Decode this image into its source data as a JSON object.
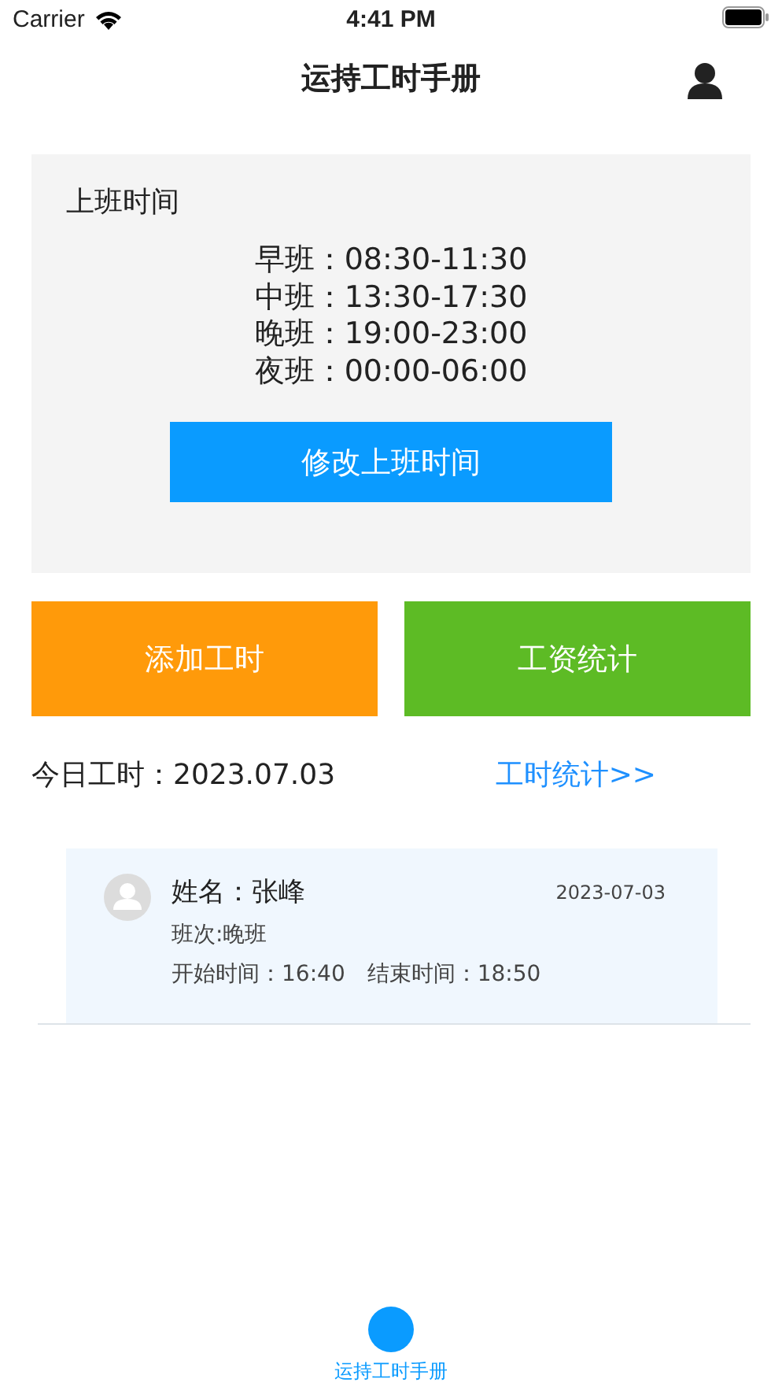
{
  "status_bar": {
    "carrier": "Carrier",
    "time": "4:41 PM"
  },
  "nav": {
    "title": "运持工时手册"
  },
  "schedule": {
    "title": "上班时间",
    "shifts": [
      "早班：08:30-11:30",
      "中班：13:30-17:30",
      "晚班：19:00-23:00",
      "夜班：00:00-06:00"
    ],
    "edit_button": "修改上班时间"
  },
  "actions": [
    {
      "label": "添加工时",
      "color": "#ff9a0a"
    },
    {
      "label": "工资统计",
      "color": "#5dbb25"
    }
  ],
  "today": {
    "label": "今日工时：2023.07.03",
    "link": "工时统计>>"
  },
  "records": [
    {
      "name": "姓名：张峰",
      "date": "2023-07-03",
      "shift": "班次:晚班",
      "times": "开始时间：16:40　结束时间：18:50"
    }
  ],
  "tabs": [
    {
      "label": "运持工时手册",
      "selected": true
    }
  ]
}
